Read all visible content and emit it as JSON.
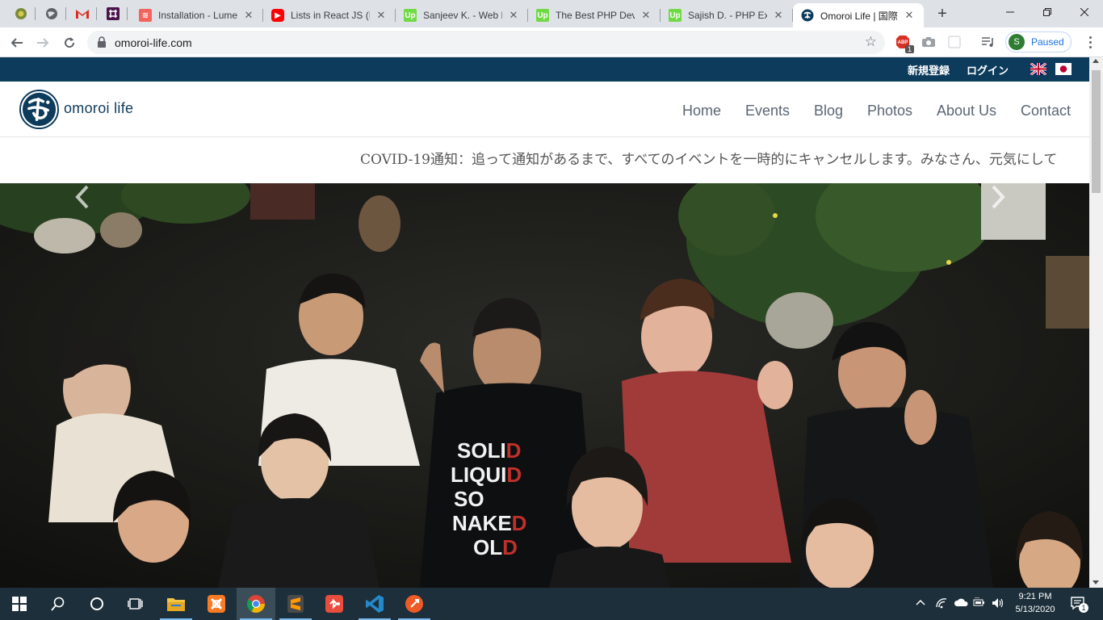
{
  "browser": {
    "tabs": [
      {
        "title": "Installation - Lume",
        "favicon": "laravel-icon",
        "color": "#f4645f"
      },
      {
        "title": "Lists in React JS (H",
        "favicon": "youtube-icon",
        "color": "#ff0000"
      },
      {
        "title": "Sanjeev K. - Web D",
        "favicon": "upwork-icon",
        "color": "#6fda44"
      },
      {
        "title": "The Best PHP Deve",
        "favicon": "upwork-icon",
        "color": "#6fda44"
      },
      {
        "title": "Sajish D. - PHP Exp",
        "favicon": "upwork-icon",
        "color": "#6fda44"
      },
      {
        "title": "Omoroi Life | 国際",
        "favicon": "omoroi-icon",
        "color": "#0d3b5c",
        "active": true
      }
    ],
    "url": "omoroi-life.com",
    "profile_initial": "S",
    "profile_status": "Paused",
    "adblock_count": "1"
  },
  "site": {
    "topbar": {
      "signup": "新規登録",
      "login": "ログイン",
      "lang_en": "English flag",
      "lang_ja": "Japanese flag",
      "bg_color": "#0d3b5c"
    },
    "brand": "omoroi life",
    "nav": [
      "Home",
      "Events",
      "Blog",
      "Photos",
      "About Us",
      "Contact"
    ],
    "notice": "COVID-19通知：追って通知があるまで、すべてのイベントを一時的にキャンセルします。みなさん、元気にして",
    "hero": {
      "shirt_text": [
        "SOLID",
        "LIQUID",
        "SO",
        "NAKE",
        "OLD"
      ]
    }
  },
  "taskbar": {
    "apps": [
      "start-icon",
      "search-icon",
      "cortana-icon",
      "task-view-icon",
      "file-explorer-icon",
      "xampp-icon",
      "chrome-icon",
      "sublime-icon",
      "git-icon",
      "vscode-icon",
      "postman-icon"
    ],
    "time": "9:21 PM",
    "date": "5/13/2020",
    "notification_count": "1"
  }
}
